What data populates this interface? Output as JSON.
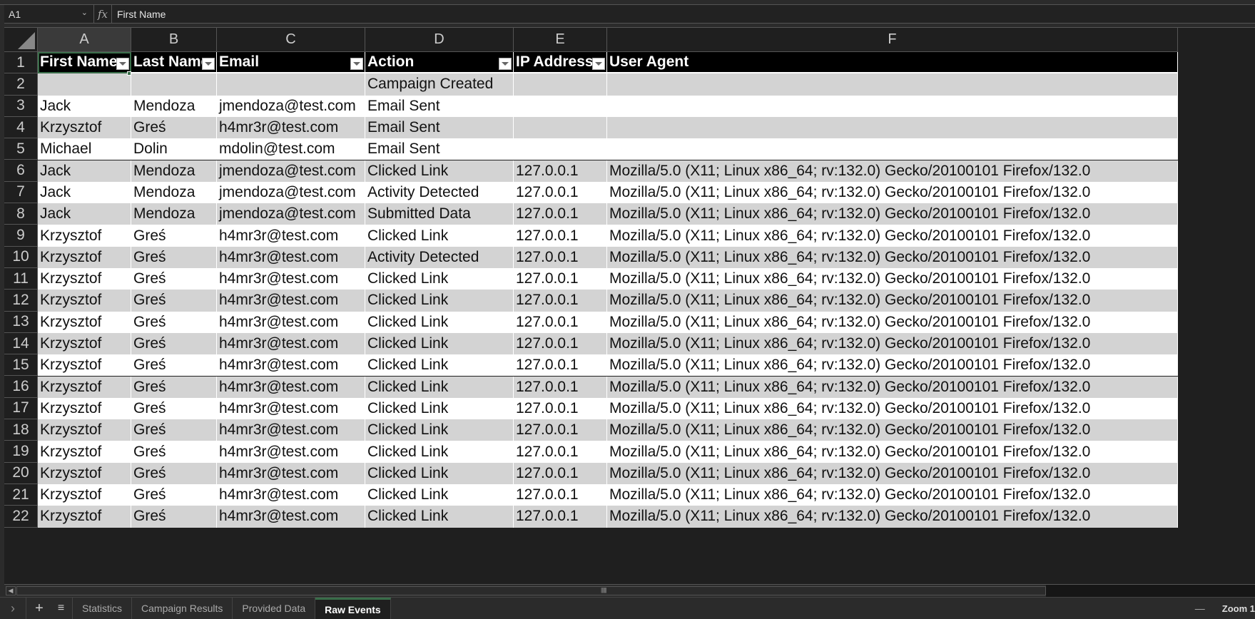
{
  "formula_bar": {
    "cell_ref": "A1",
    "fx_label": "fx",
    "content": "First Name"
  },
  "columns": [
    "A",
    "B",
    "C",
    "D",
    "E",
    "F"
  ],
  "selected_column": "A",
  "selected_cell": "A1",
  "header_row": [
    "First Name",
    "Last Name",
    "Email",
    "Action",
    "IP Address",
    "User Agent"
  ],
  "header_filters": [
    true,
    true,
    true,
    true,
    true,
    false
  ],
  "rows": [
    {
      "num": "2",
      "cells": [
        "",
        "",
        "",
        "Campaign Created",
        "",
        ""
      ]
    },
    {
      "num": "3",
      "cells": [
        "Jack",
        "Mendoza",
        "jmendoza@test.com",
        "Email Sent",
        "",
        ""
      ]
    },
    {
      "num": "4",
      "cells": [
        "Krzysztof",
        "Greś",
        "h4mr3r@test.com",
        "Email Sent",
        "",
        ""
      ]
    },
    {
      "num": "5",
      "cells": [
        "Michael",
        "Dolin",
        "mdolin@test.com",
        "Email Sent",
        "",
        ""
      ]
    },
    {
      "num": "6",
      "cells": [
        "Jack",
        "Mendoza",
        "jmendoza@test.com",
        "Clicked Link",
        "127.0.0.1",
        "Mozilla/5.0 (X11; Linux x86_64; rv:132.0) Gecko/20100101 Firefox/132.0"
      ]
    },
    {
      "num": "7",
      "cells": [
        "Jack",
        "Mendoza",
        "jmendoza@test.com",
        "Activity Detected",
        "127.0.0.1",
        "Mozilla/5.0 (X11; Linux x86_64; rv:132.0) Gecko/20100101 Firefox/132.0"
      ]
    },
    {
      "num": "8",
      "cells": [
        "Jack",
        "Mendoza",
        "jmendoza@test.com",
        "Submitted Data",
        "127.0.0.1",
        "Mozilla/5.0 (X11; Linux x86_64; rv:132.0) Gecko/20100101 Firefox/132.0"
      ]
    },
    {
      "num": "9",
      "cells": [
        "Krzysztof",
        "Greś",
        "h4mr3r@test.com",
        "Clicked Link",
        "127.0.0.1",
        "Mozilla/5.0 (X11; Linux x86_64; rv:132.0) Gecko/20100101 Firefox/132.0"
      ]
    },
    {
      "num": "10",
      "cells": [
        "Krzysztof",
        "Greś",
        "h4mr3r@test.com",
        "Activity Detected",
        "127.0.0.1",
        "Mozilla/5.0 (X11; Linux x86_64; rv:132.0) Gecko/20100101 Firefox/132.0"
      ]
    },
    {
      "num": "11",
      "cells": [
        "Krzysztof",
        "Greś",
        "h4mr3r@test.com",
        "Clicked Link",
        "127.0.0.1",
        "Mozilla/5.0 (X11; Linux x86_64; rv:132.0) Gecko/20100101 Firefox/132.0"
      ]
    },
    {
      "num": "12",
      "cells": [
        "Krzysztof",
        "Greś",
        "h4mr3r@test.com",
        "Clicked Link",
        "127.0.0.1",
        "Mozilla/5.0 (X11; Linux x86_64; rv:132.0) Gecko/20100101 Firefox/132.0"
      ]
    },
    {
      "num": "13",
      "cells": [
        "Krzysztof",
        "Greś",
        "h4mr3r@test.com",
        "Clicked Link",
        "127.0.0.1",
        "Mozilla/5.0 (X11; Linux x86_64; rv:132.0) Gecko/20100101 Firefox/132.0"
      ]
    },
    {
      "num": "14",
      "cells": [
        "Krzysztof",
        "Greś",
        "h4mr3r@test.com",
        "Clicked Link",
        "127.0.0.1",
        "Mozilla/5.0 (X11; Linux x86_64; rv:132.0) Gecko/20100101 Firefox/132.0"
      ]
    },
    {
      "num": "15",
      "cells": [
        "Krzysztof",
        "Greś",
        "h4mr3r@test.com",
        "Clicked Link",
        "127.0.0.1",
        "Mozilla/5.0 (X11; Linux x86_64; rv:132.0) Gecko/20100101 Firefox/132.0"
      ]
    },
    {
      "num": "16",
      "cells": [
        "Krzysztof",
        "Greś",
        "h4mr3r@test.com",
        "Clicked Link",
        "127.0.0.1",
        "Mozilla/5.0 (X11; Linux x86_64; rv:132.0) Gecko/20100101 Firefox/132.0"
      ]
    },
    {
      "num": "17",
      "cells": [
        "Krzysztof",
        "Greś",
        "h4mr3r@test.com",
        "Clicked Link",
        "127.0.0.1",
        "Mozilla/5.0 (X11; Linux x86_64; rv:132.0) Gecko/20100101 Firefox/132.0"
      ]
    },
    {
      "num": "18",
      "cells": [
        "Krzysztof",
        "Greś",
        "h4mr3r@test.com",
        "Clicked Link",
        "127.0.0.1",
        "Mozilla/5.0 (X11; Linux x86_64; rv:132.0) Gecko/20100101 Firefox/132.0"
      ]
    },
    {
      "num": "19",
      "cells": [
        "Krzysztof",
        "Greś",
        "h4mr3r@test.com",
        "Clicked Link",
        "127.0.0.1",
        "Mozilla/5.0 (X11; Linux x86_64; rv:132.0) Gecko/20100101 Firefox/132.0"
      ]
    },
    {
      "num": "20",
      "cells": [
        "Krzysztof",
        "Greś",
        "h4mr3r@test.com",
        "Clicked Link",
        "127.0.0.1",
        "Mozilla/5.0 (X11; Linux x86_64; rv:132.0) Gecko/20100101 Firefox/132.0"
      ]
    },
    {
      "num": "21",
      "cells": [
        "Krzysztof",
        "Greś",
        "h4mr3r@test.com",
        "Clicked Link",
        "127.0.0.1",
        "Mozilla/5.0 (X11; Linux x86_64; rv:132.0) Gecko/20100101 Firefox/132.0"
      ]
    },
    {
      "num": "22",
      "cells": [
        "Krzysztof",
        "Greś",
        "h4mr3r@test.com",
        "Clicked Link",
        "127.0.0.1",
        "Mozilla/5.0 (X11; Linux x86_64; rv:132.0) Gecko/20100101 Firefox/132.0"
      ]
    }
  ],
  "sheet_tabs": [
    {
      "label": "Statistics",
      "active": false
    },
    {
      "label": "Campaign Results",
      "active": false
    },
    {
      "label": "Provided Data",
      "active": false
    },
    {
      "label": "Raw Events",
      "active": true
    }
  ],
  "status": {
    "zoom_label": "Zoom 1",
    "zoom_minus": "—"
  },
  "icons": {
    "namebox_chevron": "chevron-down-icon",
    "scroll_sheets": "chevron-right-icon",
    "add_sheet": "plus-icon",
    "sheet_list": "list-icon",
    "scroll_left": "arrow-left-icon"
  },
  "colors": {
    "accent": "#3a6e4a",
    "header_bg": "#000000",
    "band_gray": "#d3d3d3"
  }
}
